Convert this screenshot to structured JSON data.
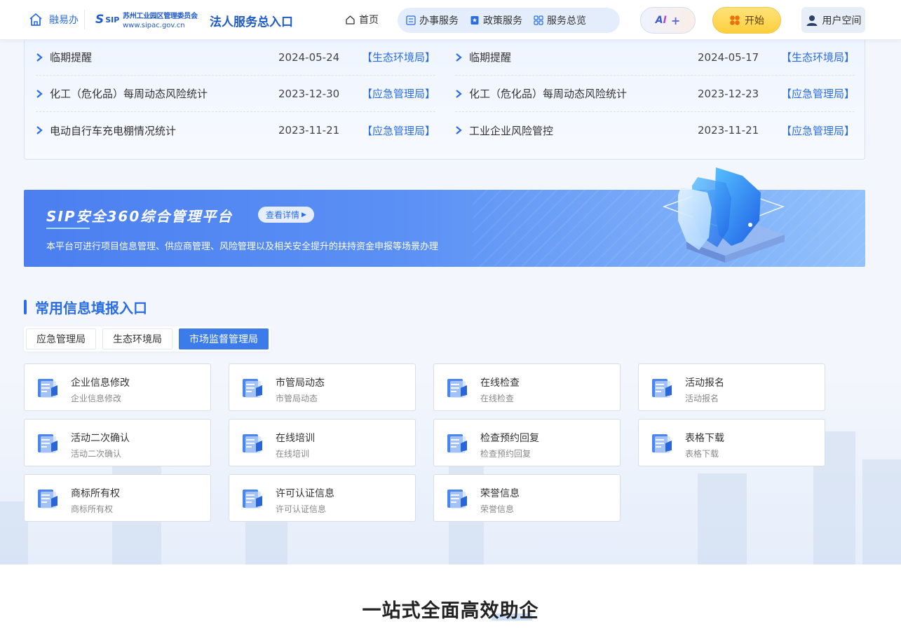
{
  "header": {
    "rongyiban": "融易办",
    "sip_mark": "S",
    "sip_text": "SIP",
    "org_name": "苏州工业园区管理委员会",
    "org_url": "www.sipac.gov.cn",
    "portal_title": "法人服务总入口",
    "nav_home": "首页",
    "nav_items": [
      "办事服务",
      "政策服务",
      "服务总览"
    ],
    "ai_a": "A",
    "ai_i": "I",
    "ai_plus": "+",
    "start_label": "开始",
    "user_label": "用户空间"
  },
  "notices": {
    "left": [
      {
        "title": "临期提醒",
        "date": "2024-05-24",
        "dept": "【生态环境局】"
      },
      {
        "title": "化工（危化品）每周动态风险统计",
        "date": "2023-12-30",
        "dept": "【应急管理局】"
      },
      {
        "title": "电动自行车充电棚情况统计",
        "date": "2023-11-21",
        "dept": "【应急管理局】"
      }
    ],
    "right": [
      {
        "title": "临期提醒",
        "date": "2024-05-17",
        "dept": "【生态环境局】"
      },
      {
        "title": "化工（危化品）每周动态风险统计",
        "date": "2023-12-23",
        "dept": "【应急管理局】"
      },
      {
        "title": "工业企业风险管控",
        "date": "2023-11-21",
        "dept": "【应急管理局】"
      }
    ]
  },
  "banner": {
    "title": "SIP安全360综合管理平台",
    "detail_label": "查看详情",
    "description": "本平台可进行项目信息管理、供应商管理、风险管理以及相关安全提升的扶持资金申报等场景办理"
  },
  "section": {
    "title": "常用信息填报入口",
    "tabs": [
      "应急管理局",
      "生态环境局",
      "市场监督管理局"
    ],
    "active_tab": 2,
    "cards": [
      {
        "title": "企业信息修改",
        "sub": "企业信息修改"
      },
      {
        "title": "市管局动态",
        "sub": "市管局动态"
      },
      {
        "title": "在线检查",
        "sub": "在线检查"
      },
      {
        "title": "活动报名",
        "sub": "活动报名"
      },
      {
        "title": "活动二次确认",
        "sub": "活动二次确认"
      },
      {
        "title": "在线培训",
        "sub": "在线培训"
      },
      {
        "title": "检查预约回复",
        "sub": "检查预约回复"
      },
      {
        "title": "表格下载",
        "sub": "表格下载"
      },
      {
        "title": "商标所有权",
        "sub": "商标所有权"
      },
      {
        "title": "许可认证信息",
        "sub": "许可认证信息"
      },
      {
        "title": "荣誉信息",
        "sub": "荣誉信息"
      }
    ]
  },
  "bottom": {
    "title": "一站式全面高效助企"
  },
  "colors": {
    "primary": "#2b6de5",
    "tab_active": "#3b7cea",
    "start_yellow": "#fbcf3d"
  }
}
